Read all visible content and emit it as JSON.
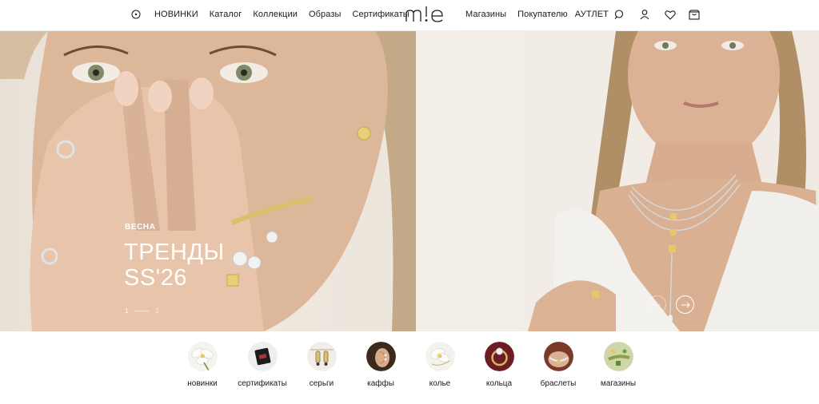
{
  "header": {
    "nav_left": [
      "НОВИНКИ",
      "Каталог",
      "Коллекции",
      "Образы",
      "Сертификаты"
    ],
    "logo_text": "m!e",
    "nav_right": [
      "Магазины",
      "Покупателю",
      "АУТЛЕТ"
    ],
    "icons": [
      "location-pin-icon",
      "search-icon",
      "user-icon",
      "heart-icon",
      "bag-icon"
    ]
  },
  "hero": {
    "kicker": "ВЕСНА",
    "title": "ТРЕНДЫ\nSS'26",
    "pager": {
      "current": "1",
      "next": "2"
    },
    "colors": {
      "text": "#ffffff"
    }
  },
  "categories": [
    {
      "label": "новинки",
      "thumb": "flower"
    },
    {
      "label": "сертификаты",
      "thumb": "gift-box"
    },
    {
      "label": "серьги",
      "thumb": "earrings"
    },
    {
      "label": "каффы",
      "thumb": "ear-cuff"
    },
    {
      "label": "колье",
      "thumb": "necklace"
    },
    {
      "label": "кольца",
      "thumb": "ring"
    },
    {
      "label": "браслеты",
      "thumb": "bracelet"
    },
    {
      "label": "магазины",
      "thumb": "store"
    }
  ]
}
